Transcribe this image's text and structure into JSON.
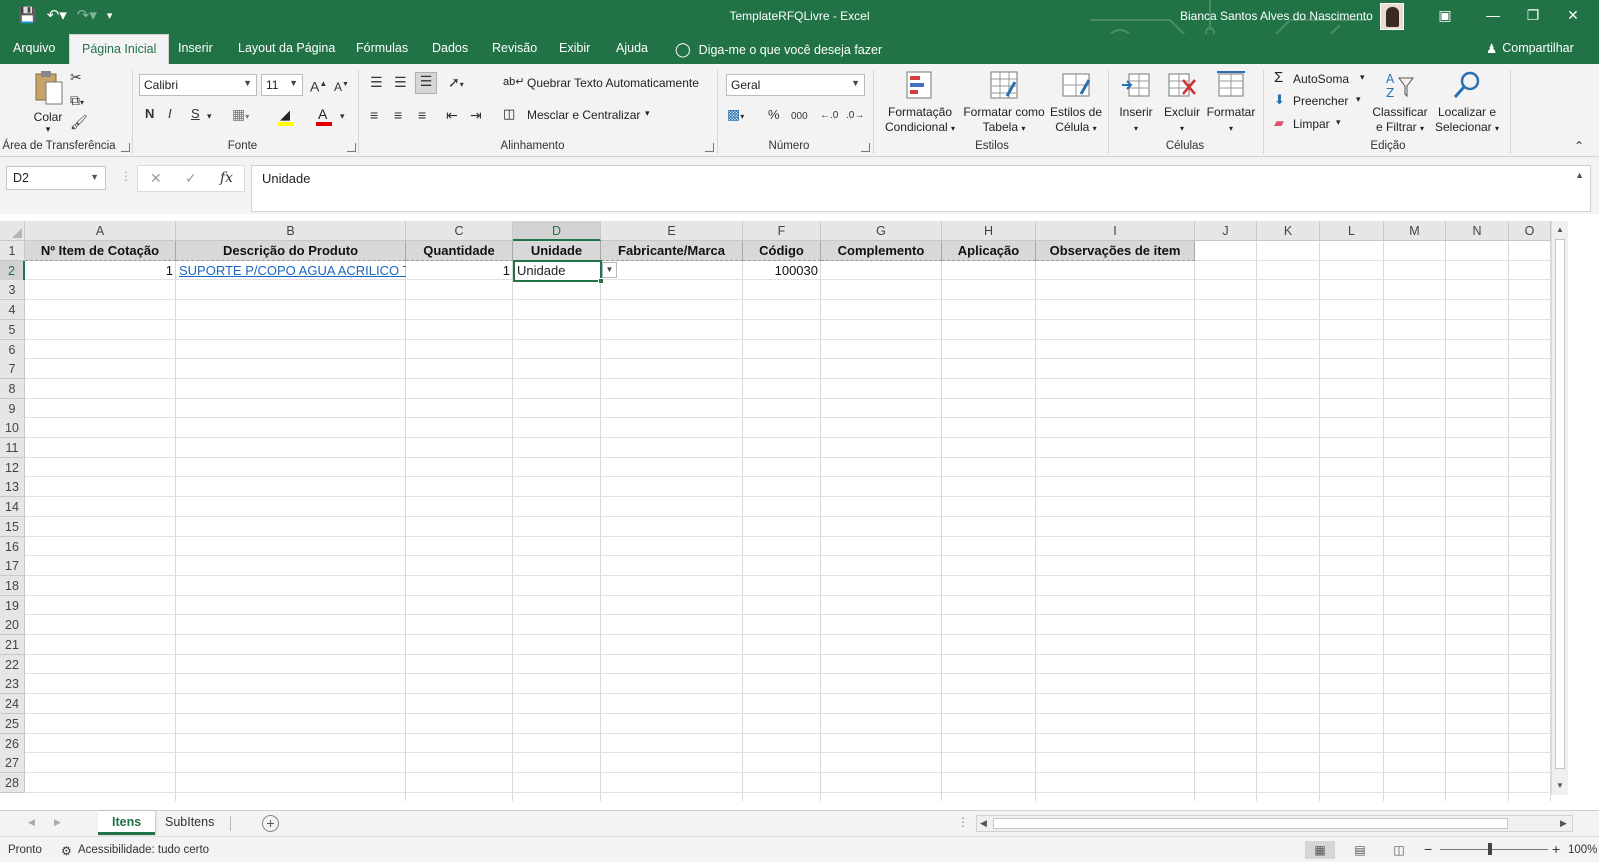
{
  "window": {
    "title": "TemplateRFQLivre  -  Excel",
    "user": "Bianca Santos Alves do Nascimento",
    "qat": [
      "save-icon",
      "undo-icon",
      "redo-icon",
      "customize-icon"
    ]
  },
  "tabs": [
    "Arquivo",
    "Página Inicial",
    "Inserir",
    "Layout da Página",
    "Fórmulas",
    "Dados",
    "Revisão",
    "Exibir",
    "Ajuda"
  ],
  "active_tab": "Página Inicial",
  "tell_me": "Diga-me o que você deseja fazer",
  "share": "Compartilhar",
  "ribbon": {
    "clipboard": {
      "label": "Área de Transferência",
      "paste": "Colar"
    },
    "font": {
      "label": "Fonte",
      "name": "Calibri",
      "size": "11",
      "bold": "N",
      "italic": "I",
      "underline": "S"
    },
    "alignment": {
      "label": "Alinhamento",
      "wrap": "Quebrar Texto Automaticamente",
      "merge": "Mesclar e Centralizar"
    },
    "number": {
      "label": "Número",
      "format": "Geral",
      "percent": "%",
      "thousands": "000"
    },
    "styles": {
      "label": "Estilos",
      "conditional_1": "Formatação",
      "conditional_2": "Condicional",
      "table_1": "Formatar como",
      "table_2": "Tabela",
      "cell_1": "Estilos de",
      "cell_2": "Célula"
    },
    "cells": {
      "label": "Células",
      "insert": "Inserir",
      "delete": "Excluir",
      "format": "Formatar"
    },
    "editing": {
      "label": "Edição",
      "autosum": "AutoSoma",
      "fill": "Preencher",
      "clear": "Limpar",
      "sort_1": "Classificar",
      "sort_2": "e Filtrar",
      "find_1": "Localizar e",
      "find_2": "Selecionar"
    }
  },
  "formula_bar": {
    "name_box": "D2",
    "content": "Unidade",
    "fx": "fx"
  },
  "grid": {
    "columns": [
      "A",
      "B",
      "C",
      "D",
      "E",
      "F",
      "G",
      "H",
      "I",
      "J",
      "K",
      "L",
      "M",
      "N",
      "O"
    ],
    "selected_column": "D",
    "rows": [
      "1",
      "2",
      "3",
      "4",
      "5",
      "6",
      "7",
      "8",
      "9",
      "10",
      "11",
      "12",
      "13",
      "14",
      "15",
      "16",
      "17",
      "18",
      "19",
      "20",
      "21",
      "22",
      "23",
      "24",
      "25",
      "26",
      "27",
      "28"
    ],
    "selected_row": "2",
    "headers": [
      "Nº Item de Cotação",
      "Descrição do Produto",
      "Quantidade",
      "Unidade",
      "Fabricante/Marca",
      "Código",
      "Complemento",
      "Aplicação",
      "Observações de item"
    ],
    "row2": {
      "item": "1",
      "description": "SUPORTE P/COPO AGUA ACRILICO TRI",
      "quantity": "1",
      "unit": "Unidade",
      "code": "100030"
    }
  },
  "sheets": [
    "Itens",
    "SubItens"
  ],
  "active_sheet": "Itens",
  "status": {
    "ready": "Pronto",
    "accessibility": "Acessibilidade: tudo certo",
    "zoom": "100%"
  },
  "colors": {
    "excel_green": "#217346",
    "link": "#1a66c2",
    "header_fill": "#d8d8d8"
  }
}
